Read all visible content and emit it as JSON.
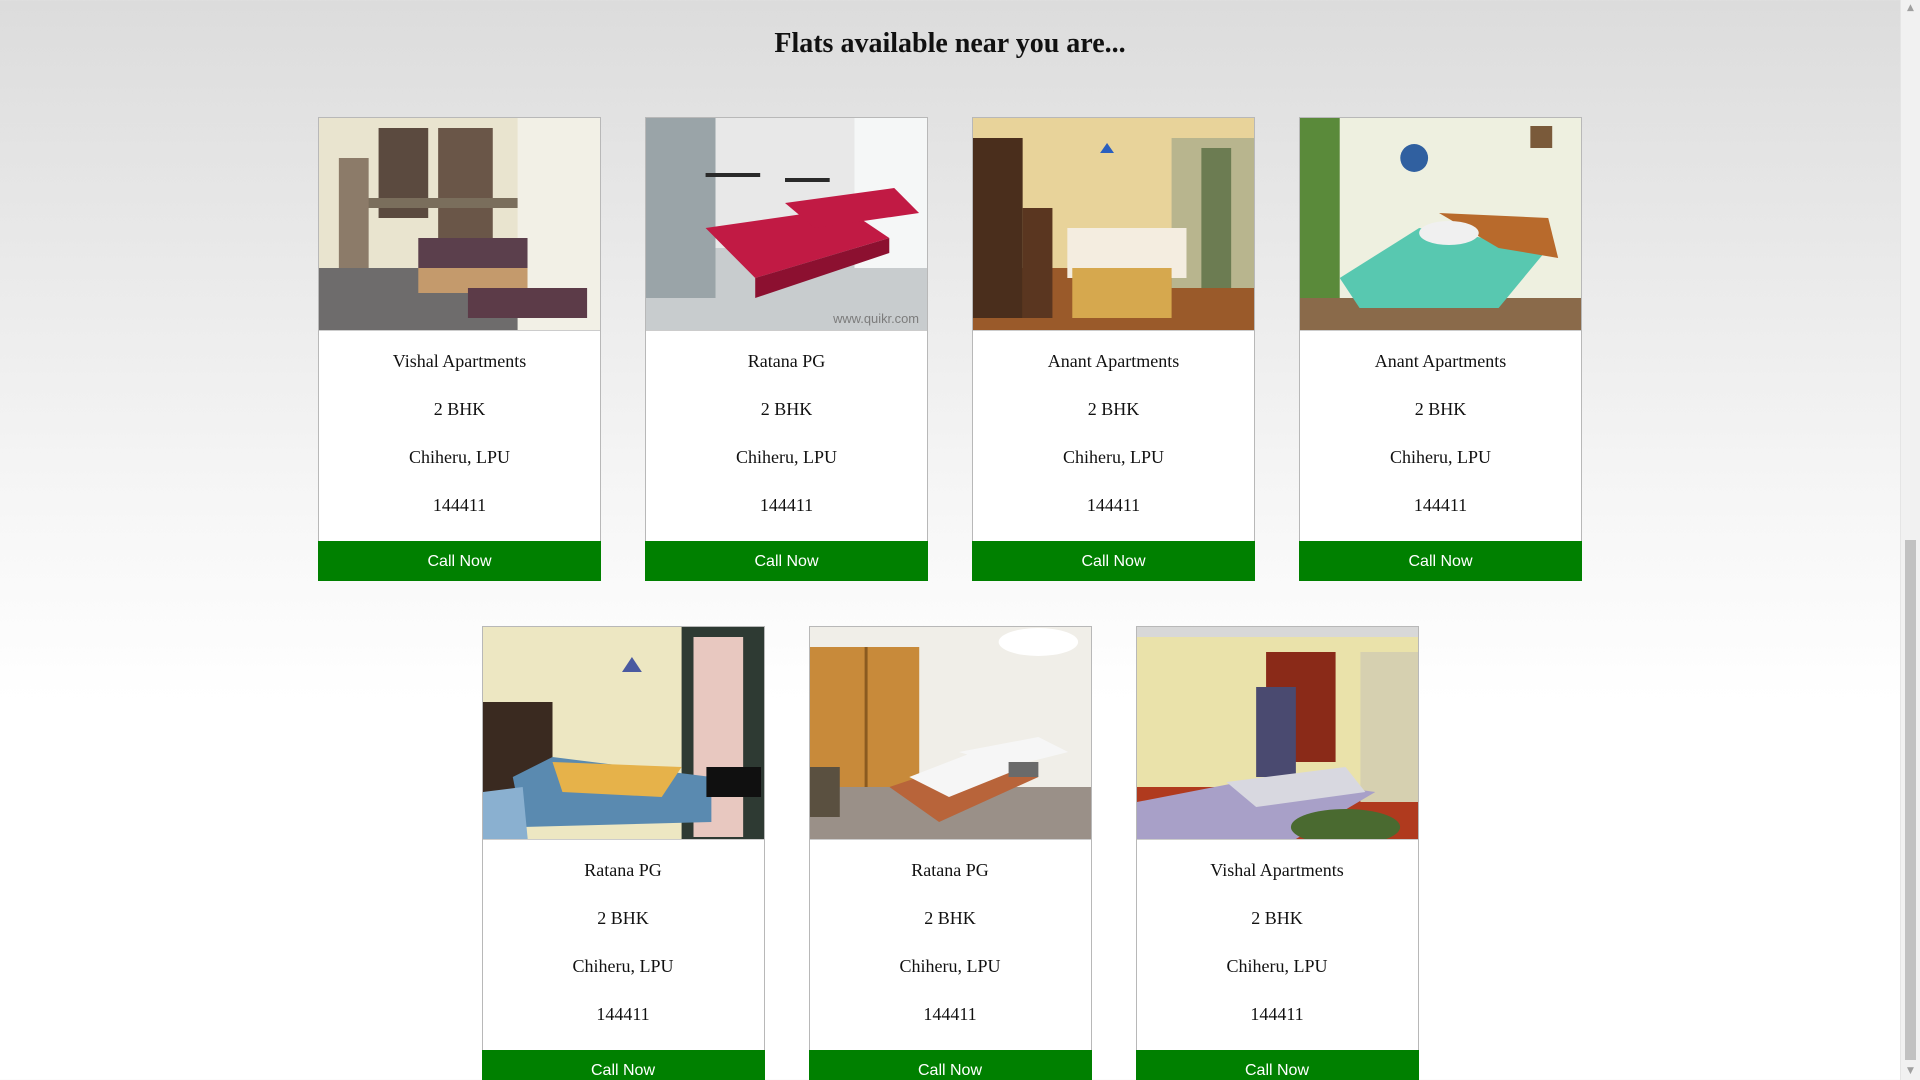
{
  "page": {
    "heading": "Flats available near you are..."
  },
  "listings": [
    {
      "name": "Vishal Apartments",
      "type": "2 BHK",
      "location": "Chiheru, LPU",
      "pin": "144411",
      "cta": "Call Now",
      "photo": "room-photo-1"
    },
    {
      "name": "Ratana PG",
      "type": "2 BHK",
      "location": "Chiheru, LPU",
      "pin": "144411",
      "cta": "Call Now",
      "photo": "room-photo-2"
    },
    {
      "name": "Anant Apartments",
      "type": "2 BHK",
      "location": "Chiheru, LPU",
      "pin": "144411",
      "cta": "Call Now",
      "photo": "room-photo-3"
    },
    {
      "name": "Anant Apartments",
      "type": "2 BHK",
      "location": "Chiheru, LPU",
      "pin": "144411",
      "cta": "Call Now",
      "photo": "room-photo-4"
    },
    {
      "name": "Ratana PG",
      "type": "2 BHK",
      "location": "Chiheru, LPU",
      "pin": "144411",
      "cta": "Call Now",
      "photo": "room-photo-5"
    },
    {
      "name": "Ratana PG",
      "type": "2 BHK",
      "location": "Chiheru, LPU",
      "pin": "144411",
      "cta": "Call Now",
      "photo": "room-photo-6"
    },
    {
      "name": "Vishal Apartments",
      "type": "2 BHK",
      "location": "Chiheru, LPU",
      "pin": "144411",
      "cta": "Call Now",
      "photo": "room-photo-7"
    }
  ],
  "colors": {
    "button_bg": "#008000",
    "button_text": "#ffffff"
  },
  "watermark": "www.quikr.com"
}
